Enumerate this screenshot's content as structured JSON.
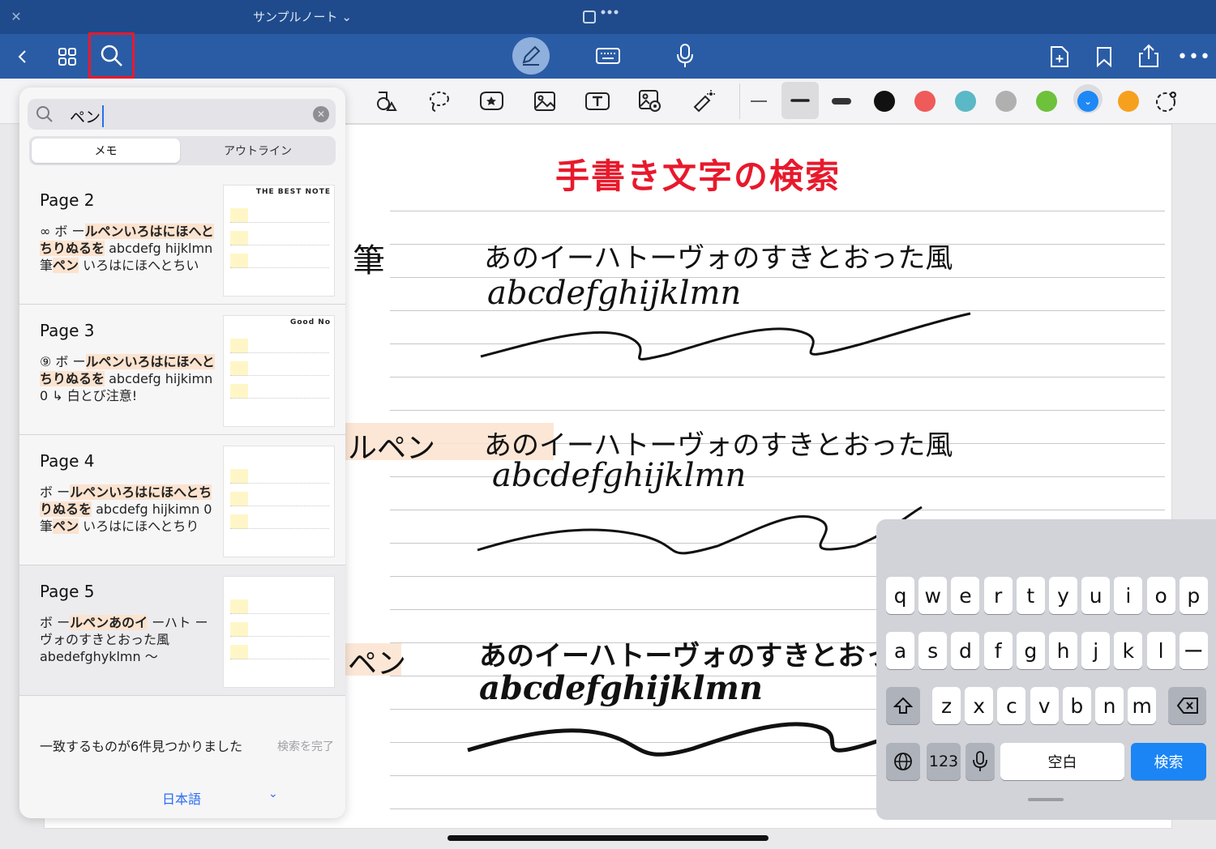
{
  "header": {
    "close_icon": "close-icon",
    "notebook_title": "サンプルノート ⌄",
    "actions": [
      "back-icon",
      "grid-icon",
      "search-icon",
      "pen-icon",
      "keyboard-icon",
      "mic-icon",
      "add-page-icon",
      "bookmark-icon",
      "share-icon",
      "more-icon"
    ]
  },
  "toolbar": {
    "tools": [
      "shapes-icon",
      "lasso-icon",
      "sticker-icon",
      "image-icon",
      "text-icon",
      "camera-icon",
      "laser-icon"
    ],
    "colors": [
      "#111111",
      "#ef5a5a",
      "#5bb8c6",
      "#b0b0b0",
      "#6ec13b",
      "#1e88f5",
      "#f6a11e"
    ]
  },
  "note": {
    "title": "手書き文字の検索",
    "left_fragments": [
      "筆",
      "ルペン",
      "ペン"
    ],
    "lines": [
      "あのイーハトーヴォのすきとおった風",
      "abcdefghijklmn",
      "あのイーハトーヴォのすきとおった風",
      "abcdefghijklmn",
      "あのイーハトーヴォのすきとおった風",
      "abcdefghijklmn"
    ]
  },
  "search": {
    "query": "ペン",
    "tabs": [
      "メモ",
      "アウトライン"
    ],
    "results": [
      {
        "page": "Page 2",
        "snippet": [
          [
            "∞ ボ ー",
            false
          ],
          [
            "ルペンいろはにほへとちりぬるを",
            true
          ],
          [
            " abcdefg hijklmn 筆",
            false
          ],
          [
            "ペン",
            true
          ],
          [
            " いろはにほへとちい",
            false
          ]
        ],
        "thumb_header": "THE BEST NOTE"
      },
      {
        "page": "Page 3",
        "snippet": [
          [
            "⑨ ボ ー",
            false
          ],
          [
            "ルペンいろはにほへとちりぬるを",
            true
          ],
          [
            " abcdefg hijkimn 0 ↳ 白とび注意!",
            false
          ]
        ],
        "thumb_header": "Good No"
      },
      {
        "page": "Page 4",
        "snippet": [
          [
            "ボ ー",
            false
          ],
          [
            "ルペンいろはにほへとちりぬるを",
            true
          ],
          [
            " abcdefg hijkimn 0 筆",
            false
          ],
          [
            "ペン",
            true
          ],
          [
            " いろはにほへとちり",
            false
          ]
        ],
        "thumb_header": ""
      },
      {
        "page": "Page 5",
        "snippet": [
          [
            "ボ ー",
            false
          ],
          [
            "ルペンあのイ",
            true
          ],
          [
            " ーハト ー ヴォのすきとおった風 abedefghyklmn 〜",
            false
          ]
        ],
        "thumb_header": ""
      }
    ],
    "status": "一致するものが6件見つかりました",
    "finish": "検索を完了",
    "language": "日本語"
  },
  "keyboard": {
    "row1": [
      "q",
      "w",
      "e",
      "r",
      "t",
      "y",
      "u",
      "i",
      "o",
      "p"
    ],
    "row2": [
      "a",
      "s",
      "d",
      "f",
      "g",
      "h",
      "j",
      "k",
      "l",
      "ー"
    ],
    "row3": [
      "z",
      "x",
      "c",
      "v",
      "b",
      "n",
      "m"
    ],
    "numbers": "123",
    "space": "空白",
    "search": "検索"
  }
}
